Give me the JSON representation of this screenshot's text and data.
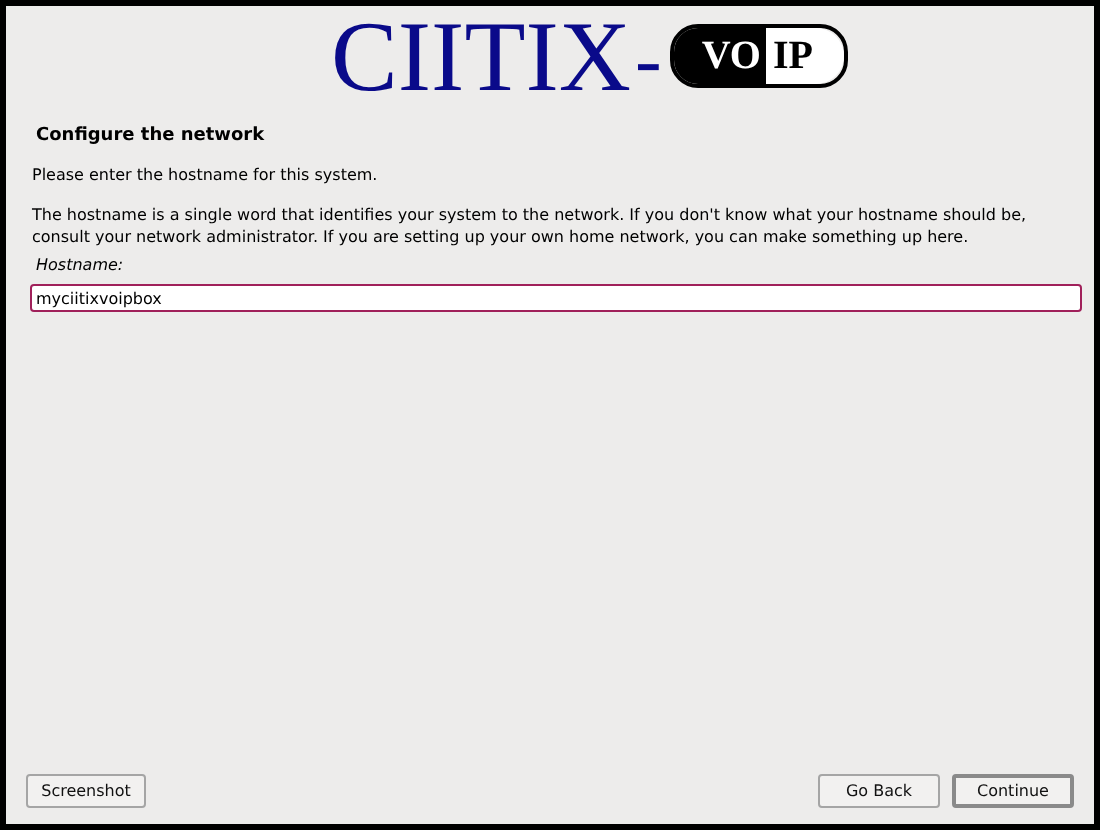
{
  "logo": {
    "name": "CIITIX",
    "dash": "-",
    "badge_left": "VO",
    "badge_right": "IP"
  },
  "title": "Configure the network",
  "prompt": "Please enter the hostname for this system.",
  "description": "The hostname is a single word that identifies your system to the network. If you don't know what your hostname should be, consult your network administrator. If you are setting up your own home network, you can make something up here.",
  "field": {
    "label": "Hostname:",
    "value": "myciitixvoipbox"
  },
  "buttons": {
    "left": [
      "Screenshot"
    ],
    "right": [
      {
        "label": "Go Back",
        "default": false
      },
      {
        "label": "Continue",
        "default": true
      }
    ]
  }
}
